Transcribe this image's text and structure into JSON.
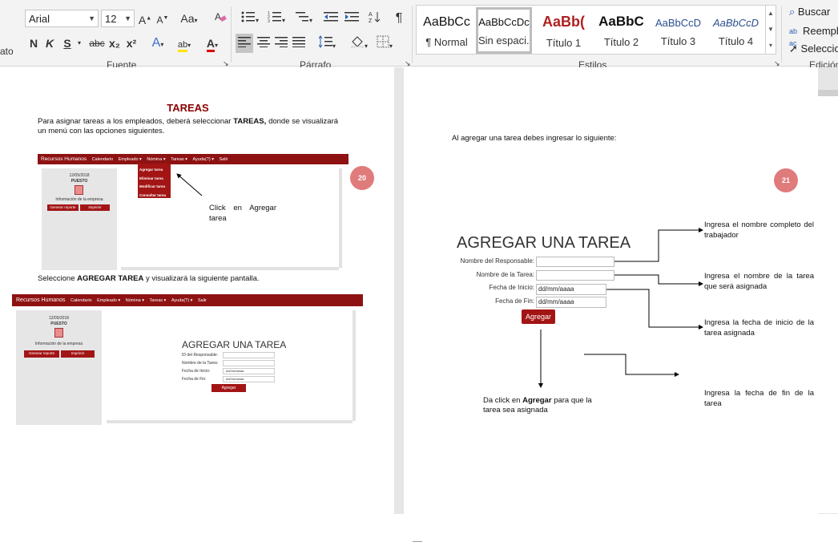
{
  "ribbon": {
    "font_name": "Arial",
    "font_size": "12",
    "clipboard_fragment": "ato",
    "styles": [
      {
        "preview": "AaBbCc",
        "name": "¶ Normal"
      },
      {
        "preview": "AaBbCcDc",
        "name": "Sin espaci..."
      },
      {
        "preview": "AaBb(",
        "name": "Título 1"
      },
      {
        "preview": "AaBbC",
        "name": "Título 2"
      },
      {
        "preview": "AaBbCcD",
        "name": "Título 3"
      },
      {
        "preview": "AaBbCcD",
        "name": "Título 4"
      }
    ],
    "editing": {
      "find": "Buscar",
      "replace": "Reemplazar",
      "select": "Seleccio"
    },
    "group_labels": {
      "font": "Fuente",
      "paragraph": "Párrafo",
      "styles": "Estilos",
      "editing": "Edición"
    },
    "icons": {
      "font_grow": "A▲",
      "font_shrink": "A▼",
      "change_case": "Aa",
      "clear_format": "eraser-icon",
      "bullets": "bullets-icon",
      "numbering": "numbering-icon",
      "multilevel": "multilevel-icon",
      "decrease_indent": "decrease-indent-icon",
      "increase_indent": "increase-indent-icon",
      "sort": "sort-icon",
      "pilcrow": "¶",
      "bold": "N",
      "italic": "K",
      "underline": "S",
      "strike": "abc",
      "subscript": "x₂",
      "superscript": "x²",
      "text_effects": "A",
      "highlight": "ab",
      "font_color": "A",
      "align_left": "align-left-icon",
      "align_center": "align-center-icon",
      "align_right": "align-right-icon",
      "justify": "justify-icon",
      "line_spacing": "line-spacing-icon",
      "shading": "shading-icon",
      "borders": "borders-icon"
    }
  },
  "page_left": {
    "title": "TAREAS",
    "intro_1": "Para asignar tareas a los empleados, deberá seleccionar",
    "intro_bold": "TAREAS,",
    "intro_2": "donde se visualizará un menú con las opciones siguientes.",
    "page_number": "20",
    "app": {
      "brand": "Recursos Humanos",
      "nav": [
        "Calendario",
        "Empleado ▾",
        "Nómina ▾",
        "Tareas ▾",
        "Ayuda(?) ▾",
        "Salir"
      ],
      "date": "12/05/2018",
      "role": "PUESTO",
      "info": "Información de la empresa",
      "btn_report": "Generar reporte",
      "btn_print": "Imprimir",
      "menu": [
        "Agregar tarea",
        "Eliminar tarea",
        "Modificar tarea",
        "Consultar tarea"
      ]
    },
    "callout": "Click en Agregar tarea",
    "sel_1": "Seleccione",
    "sel_bold": "AGREGAR TAREA",
    "sel_2": "y visualizará la siguiente pantalla.",
    "app2": {
      "brand": "Recursos Humanos",
      "nav": [
        "Calendario",
        "Empleado ▾",
        "Nómina ▾",
        "Tareas ▾",
        "Ayuda(?) ▾",
        "Salir"
      ],
      "date": "12/05/2018",
      "role": "PUESTO",
      "info": "Información de la empresa",
      "btn_report": "Generar reporte",
      "btn_print": "Imprimir",
      "form_title": "AGREGAR UNA TAREA",
      "labels": [
        "ID del Responsable:",
        "Nombre de la Tarea:",
        "Fecha de Inicio:",
        "Fecha de Fin:"
      ],
      "date_placeholder": "dd/mm/aaaa",
      "submit": "Agregar"
    }
  },
  "page_right": {
    "intro": "Al agregar una tarea debes ingresar lo siguiente:",
    "page_number": "21",
    "form_title": "AGREGAR UNA TAREA",
    "labels": [
      "Nombre del Responsable:",
      "Nombre de la Tarea:",
      "Fecha de Inicio:",
      "Fecha de Fin:"
    ],
    "date_placeholder": "dd/mm/aaaa",
    "submit": "Agregar",
    "notes": [
      "Ingresa el nombre completo del trabajador",
      "Ingresa el nombre de la tarea que será asignada",
      "Ingresa la fecha de inicio de la tarea asignada",
      "Ingresa la fecha de fin de la tarea"
    ],
    "click_note_1": "Da click en",
    "click_note_bold": "Agregar",
    "click_note_2": "para que la tarea sea asignada"
  }
}
